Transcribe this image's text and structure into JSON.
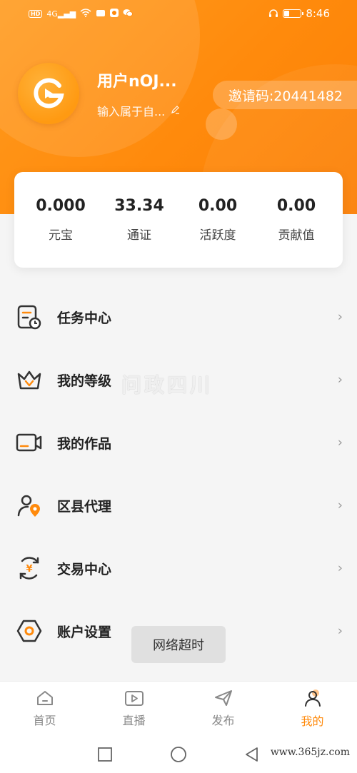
{
  "status_bar": {
    "network_badge": "HD",
    "signal": "4G",
    "time": "8:46"
  },
  "profile": {
    "username": "用户nOJ...",
    "signature_placeholder": "输入属于自...",
    "invite_code": "邀请码:20441482"
  },
  "stats": [
    {
      "value": "0.000",
      "label": "元宝"
    },
    {
      "value": "33.34",
      "label": "通证"
    },
    {
      "value": "0.00",
      "label": "活跃度"
    },
    {
      "value": "0.00",
      "label": "贡献值"
    }
  ],
  "menu": [
    {
      "label": "任务中心",
      "icon": "task-icon"
    },
    {
      "label": "我的等级",
      "icon": "crown-icon"
    },
    {
      "label": "我的作品",
      "icon": "video-icon"
    },
    {
      "label": "区县代理",
      "icon": "agent-icon"
    },
    {
      "label": "交易中心",
      "icon": "yuan-icon"
    },
    {
      "label": "账户设置",
      "icon": "settings-icon"
    }
  ],
  "watermark": "问政四川",
  "toast": "网络超时",
  "tabs": [
    {
      "label": "首页",
      "icon": "home-icon",
      "active": false
    },
    {
      "label": "直播",
      "icon": "live-icon",
      "active": false
    },
    {
      "label": "发布",
      "icon": "send-icon",
      "active": false
    },
    {
      "label": "我的",
      "icon": "user-icon",
      "active": true
    }
  ],
  "footer_url": "www.365jz.com",
  "colors": {
    "brand_orange": "#ff8a0c",
    "icon_orange": "#ff8a0c"
  }
}
